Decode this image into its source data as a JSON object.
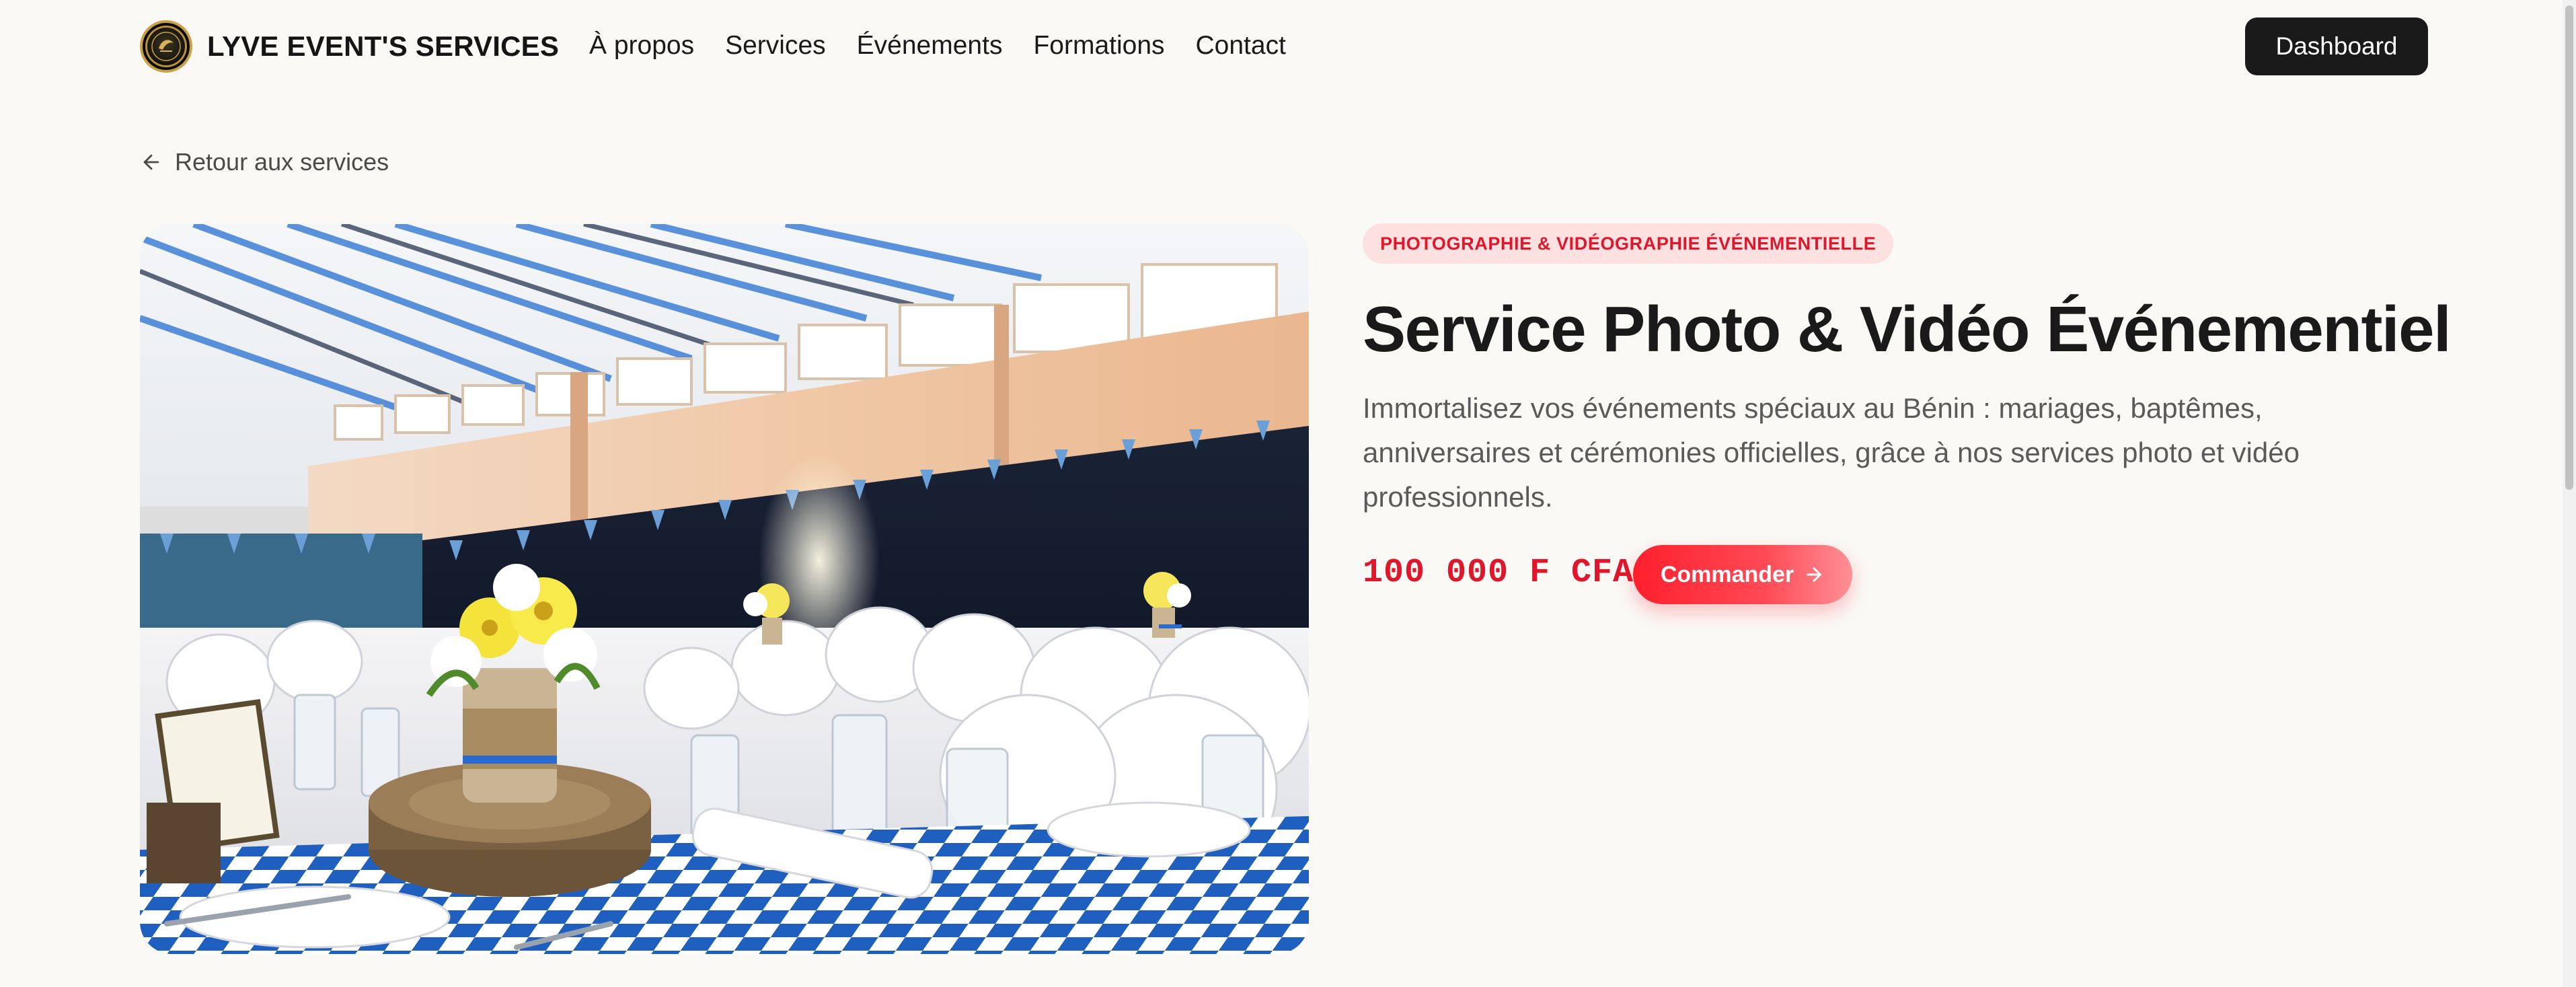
{
  "header": {
    "brand_name": "LYVE EVENT'S SERVICES",
    "logo_icon": "lyve-logo-emblem",
    "nav": [
      {
        "label": "À propos"
      },
      {
        "label": "Services"
      },
      {
        "label": "Événements"
      },
      {
        "label": "Formations"
      },
      {
        "label": "Contact"
      }
    ],
    "dashboard_label": "Dashboard"
  },
  "back_link": {
    "label": "Retour aux services",
    "icon": "arrow-left-icon"
  },
  "service": {
    "category": "PHOTOGRAPHIE & VIDÉOGRAPHIE ÉVÉNEMENTIELLE",
    "title": "Service Photo & Vidéo Événementiel",
    "description": "Immortalisez vos événements spéciaux au Bénin : mariages, baptêmes, anniversaires et cérémonies officielles, grâce à nos services photo et vidéo professionnels.",
    "price": "100 000 F CFA",
    "order_label": "Commander",
    "order_icon": "arrow-right-icon",
    "image_icon": "event-hall-photo"
  },
  "colors": {
    "accent": "#e0162b",
    "badge_bg": "#fde1e1",
    "page_bg": "#faf9f6",
    "dark_button": "#1a1a1a"
  }
}
